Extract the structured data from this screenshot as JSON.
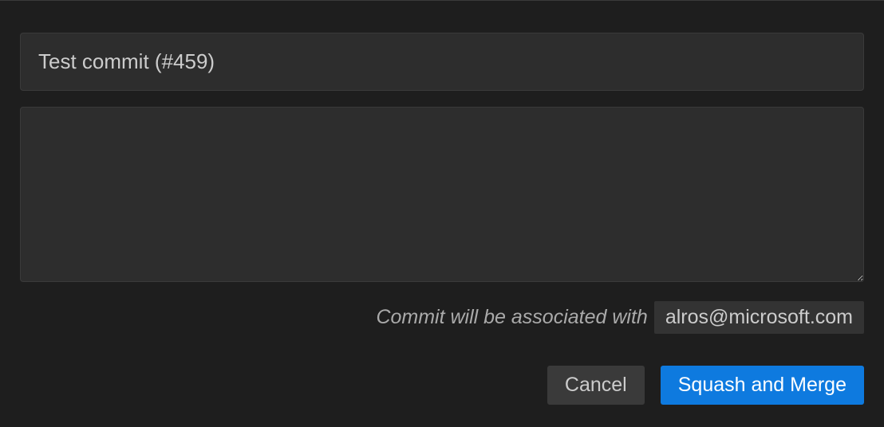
{
  "commit": {
    "title_value": "Test commit (#459)",
    "description_value": ""
  },
  "association": {
    "label": "Commit will be associated with",
    "email": "alros@microsoft.com"
  },
  "buttons": {
    "cancel": "Cancel",
    "squash_merge": "Squash and Merge"
  }
}
